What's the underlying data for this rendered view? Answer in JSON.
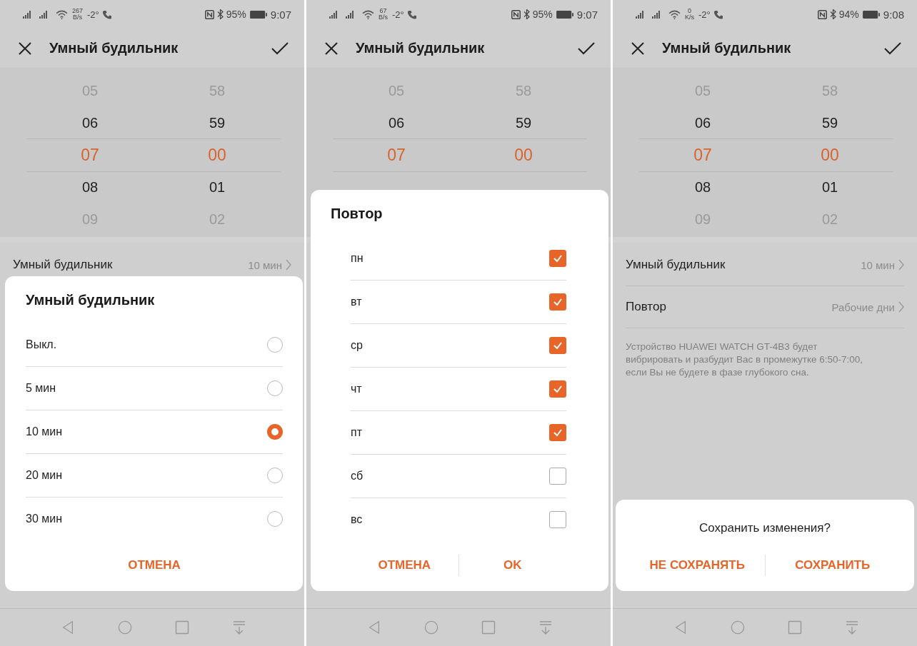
{
  "screens": [
    {
      "status": {
        "speed_value": "267",
        "speed_unit": "B/s",
        "temperature": "-2°",
        "battery": "95%",
        "time": "9:07"
      },
      "header": {
        "title": "Умный будильник"
      },
      "picker": {
        "columns": [
          {
            "items": [
              {
                "text": "05",
                "selected": false
              },
              {
                "text": "06",
                "selected": false
              },
              {
                "text": "07",
                "selected": true
              },
              {
                "text": "08",
                "selected": false
              },
              {
                "text": "09",
                "selected": false
              }
            ]
          },
          {
            "items": [
              {
                "text": "58",
                "selected": false
              },
              {
                "text": "59",
                "selected": false
              },
              {
                "text": "00",
                "selected": true
              },
              {
                "text": "01",
                "selected": false
              },
              {
                "text": "02",
                "selected": false
              }
            ]
          }
        ]
      },
      "settings": [
        {
          "label": "Умный будильник",
          "value": "10 мин"
        }
      ],
      "dialog": {
        "kind": "radio",
        "title": "Умный будильник",
        "options": [
          {
            "label": "Выкл.",
            "selected": false
          },
          {
            "label": "5 мин",
            "selected": false
          },
          {
            "label": "10 мин",
            "selected": true
          },
          {
            "label": "20 мин",
            "selected": false
          },
          {
            "label": "30 мин",
            "selected": false
          }
        ],
        "buttons": [
          "ОТМЕНА"
        ]
      }
    },
    {
      "status": {
        "speed_value": "67",
        "speed_unit": "B/s",
        "temperature": "-2°",
        "battery": "95%",
        "time": "9:07"
      },
      "header": {
        "title": "Умный будильник"
      },
      "picker": {
        "columns": [
          {
            "items": [
              {
                "text": "05",
                "selected": false
              },
              {
                "text": "06",
                "selected": false
              },
              {
                "text": "07",
                "selected": true
              }
            ]
          },
          {
            "items": [
              {
                "text": "58",
                "selected": false
              },
              {
                "text": "59",
                "selected": false
              },
              {
                "text": "00",
                "selected": true
              }
            ]
          }
        ]
      },
      "dialog": {
        "kind": "checklist",
        "title": "Повтор",
        "options": [
          {
            "label": "пн",
            "checked": true
          },
          {
            "label": "вт",
            "checked": true
          },
          {
            "label": "ср",
            "checked": true
          },
          {
            "label": "чт",
            "checked": true
          },
          {
            "label": "пт",
            "checked": true
          },
          {
            "label": "сб",
            "checked": false
          },
          {
            "label": "вс",
            "checked": false
          }
        ],
        "buttons": [
          "ОТМЕНА",
          "OK"
        ]
      }
    },
    {
      "status": {
        "speed_value": "0",
        "speed_unit": "K/s",
        "temperature": "-2°",
        "battery": "94%",
        "time": "9:08"
      },
      "header": {
        "title": "Умный будильник"
      },
      "picker": {
        "columns": [
          {
            "items": [
              {
                "text": "05",
                "selected": false
              },
              {
                "text": "06",
                "selected": false
              },
              {
                "text": "07",
                "selected": true
              },
              {
                "text": "08",
                "selected": false
              },
              {
                "text": "09",
                "selected": false
              }
            ]
          },
          {
            "items": [
              {
                "text": "58",
                "selected": false
              },
              {
                "text": "59",
                "selected": false
              },
              {
                "text": "00",
                "selected": true
              },
              {
                "text": "01",
                "selected": false
              },
              {
                "text": "02",
                "selected": false
              }
            ]
          }
        ]
      },
      "settings": [
        {
          "label": "Умный будильник",
          "value": "10 мин"
        },
        {
          "label": "Повтор",
          "value": "Рабочие дни"
        }
      ],
      "note": "Устройство HUAWEI WATCH GT-4B3 будет вибрировать и разбудит Вас в промежутке 6:50-7:00, если Вы не будете в фазе глубокого сна.",
      "dialog": {
        "kind": "confirm",
        "message": "Сохранить изменения?",
        "buttons": [
          "НЕ СОХРАНЯТЬ",
          "СОХРАНИТЬ"
        ]
      }
    }
  ]
}
